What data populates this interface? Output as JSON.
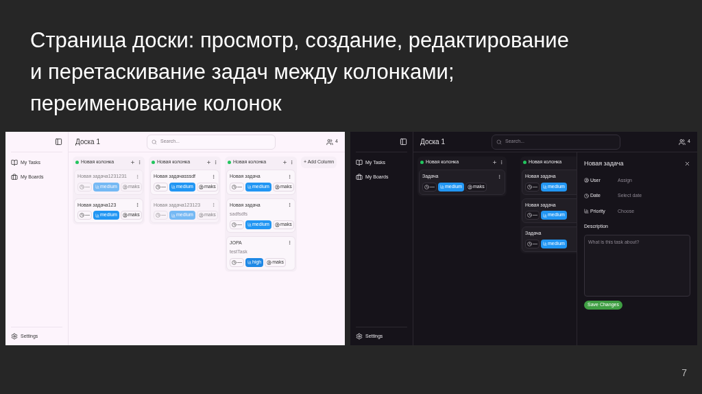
{
  "slide": {
    "title": "Страница доски: просмотр, создание, редактирование и перетаскивание задач между колонками; переименование колонок",
    "page_number": "7"
  },
  "screens": [
    {
      "dark_mode": false,
      "sidebar": {
        "items": [
          {
            "label": "My Tasks",
            "kind": "tasks"
          },
          {
            "label": "My Boards",
            "kind": "boards"
          }
        ],
        "settings": "Settings"
      },
      "board_title": "Доска 1",
      "search": {
        "placeholder": "Search..."
      },
      "members": "4",
      "add_column": "+ Add Column",
      "columns": [
        {
          "name": "Новая колонка",
          "color": "#22c55e",
          "cards": [
            {
              "title": "Новая задача1231231",
              "faded": true,
              "date": "—",
              "priority": "medium",
              "user": "maks"
            },
            {
              "title": "Новая задача123",
              "faded": false,
              "date": "—",
              "priority": "medium",
              "user": "maks"
            }
          ]
        },
        {
          "name": "Новая колонка",
          "color": "#22c55e",
          "cards": [
            {
              "title": "Новая задачаsssdf",
              "faded": false,
              "date": "—",
              "priority": "medium",
              "user": "maks"
            },
            {
              "title": "Новая задача123123",
              "faded": true,
              "date": "—",
              "priority": "medium",
              "user": "maks"
            }
          ]
        },
        {
          "name": "Новая колонка",
          "color": "#22c55e",
          "cards": [
            {
              "title": "Новая задача",
              "faded": false,
              "date": "—",
              "priority": "medium",
              "user": "maks"
            },
            {
              "title": "Новая задача",
              "subtitle": "sadfsdfs",
              "faded": false,
              "date": "—",
              "priority": "medium",
              "user": "maks"
            },
            {
              "title": "JOPA",
              "subtitle": "testTask",
              "faded": false,
              "date": "—",
              "priority": "high",
              "user": "maks"
            }
          ]
        }
      ]
    },
    {
      "dark_mode": true,
      "sidebar": {
        "items": [
          {
            "label": "My Tasks",
            "kind": "tasks"
          },
          {
            "label": "My Boards",
            "kind": "boards"
          }
        ],
        "settings": "Settings"
      },
      "board_title": "Доска 1",
      "search": {
        "placeholder": "Search..."
      },
      "members": "4",
      "columns": [
        {
          "name": "Новая колонка",
          "color": "#22c55e",
          "cards": [
            {
              "title": "Задача",
              "faded": false,
              "date": "—",
              "priority": "medium",
              "user": "maks"
            }
          ]
        },
        {
          "name": "Новая колонка",
          "color": "#22c55e",
          "cut_off": true,
          "cards": [
            {
              "title": "Новая задача",
              "faded": false,
              "date": "—",
              "priority": "medium"
            },
            {
              "title": "Новая задача",
              "faded": false,
              "date": "—",
              "priority": "medium"
            },
            {
              "title": "Задача",
              "faded": false,
              "date": "—",
              "priority": "medium"
            }
          ]
        }
      ],
      "detail_panel": {
        "title": "Новая задача",
        "fields": [
          {
            "kind": "user",
            "label": "User",
            "value": "Assign"
          },
          {
            "kind": "date",
            "label": "Date",
            "value": "Select date"
          },
          {
            "kind": "priority",
            "label": "Priority",
            "value": "Choose"
          }
        ],
        "description_label": "Description",
        "description_placeholder": "What is this task about?",
        "save_button": "Save Changes"
      }
    }
  ]
}
